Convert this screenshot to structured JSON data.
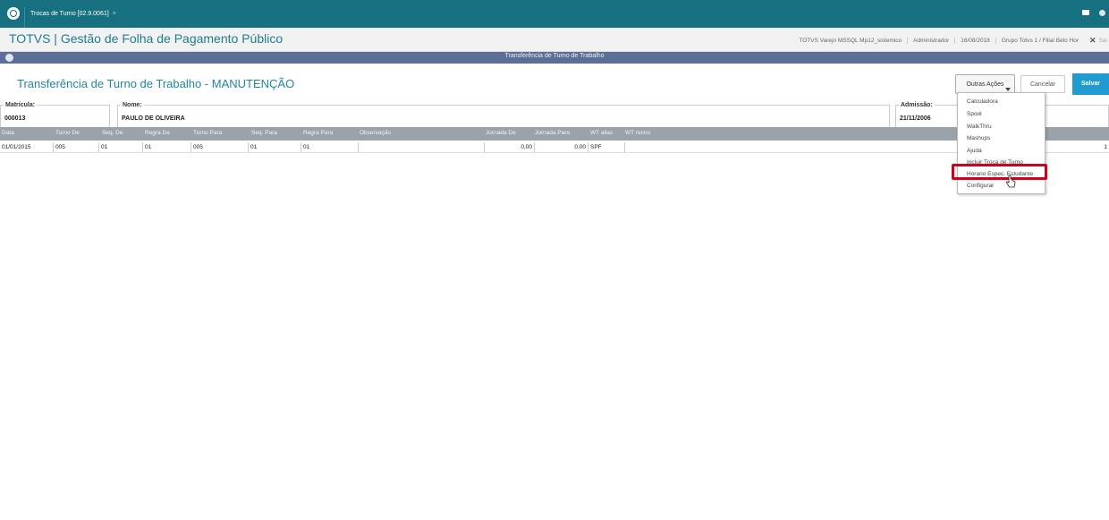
{
  "tabbar": {
    "tab_label": "Trocas de Turno [02.9.0061]",
    "tab_close": "×"
  },
  "appbar": {
    "title": "TOTVS | Gestão de Folha de Pagamento Público",
    "env_items": [
      "TOTVS Varejo MSSQL Mp12_sistemico",
      "Administrador",
      "16/08/2018",
      "Grupo Totvs 1 / Filial Belo Hor"
    ],
    "close_label": "✕",
    "exit_label": "Sai"
  },
  "dialog": {
    "title": "Transferência de Turno de Trabalho"
  },
  "page": {
    "title": "Transferência de Turno de Trabalho - MANUTENÇÃO",
    "outras_acoes": "Outras Ações",
    "cancelar": "Cancelar",
    "salvar": "Salvar"
  },
  "fields": {
    "matricula_label": "Matrícula:",
    "matricula_value": "000013",
    "nome_label": "Nome:",
    "nome_value": "PAULO DE OLIVEIRA",
    "admissao_label": "Admissão:",
    "admissao_value": "21/11/2006"
  },
  "grid": {
    "headers": [
      "Data",
      "Turno De",
      "Seq. De",
      "Regra De",
      "Turno Para",
      "Seq. Para",
      "Regra Para",
      "Observação",
      "Jornada De",
      "Jornada Para",
      "WT alias",
      "WT recno"
    ],
    "row": [
      "01/01/2015",
      "005",
      "01",
      "01",
      "005",
      "01",
      "01",
      "",
      "0,00",
      "0,00",
      "SPF",
      "",
      "1"
    ]
  },
  "menu": {
    "items": [
      "Calculadora",
      "Spool",
      "WalkThru",
      "Mashups",
      "Ajuda",
      "Incluir Troca de Turno",
      "Horario Espec. Estudante",
      "Configurar"
    ]
  },
  "colors": {
    "accent": "#16707f",
    "dialog_bar": "#5b6f98",
    "save": "#1f9bd2",
    "highlight": "#d0021b"
  }
}
